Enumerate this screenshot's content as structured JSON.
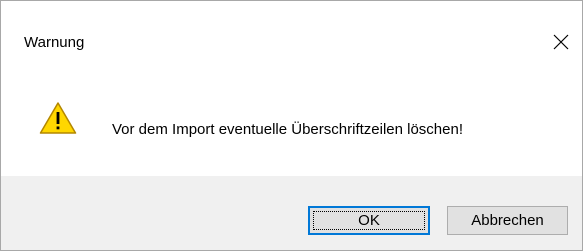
{
  "window": {
    "title": "Warnung",
    "close_icon": "close-icon"
  },
  "message": {
    "icon": "warning-icon",
    "text": "Vor dem Import eventuelle Überschriftzeilen löschen!"
  },
  "buttons": {
    "ok_label": "OK",
    "cancel_label": "Abbrechen"
  },
  "colors": {
    "warning_fill": "#ffd700",
    "warning_stroke": "#b38700",
    "focus_border": "#0078d7",
    "footer_bg": "#f0f0f0"
  }
}
